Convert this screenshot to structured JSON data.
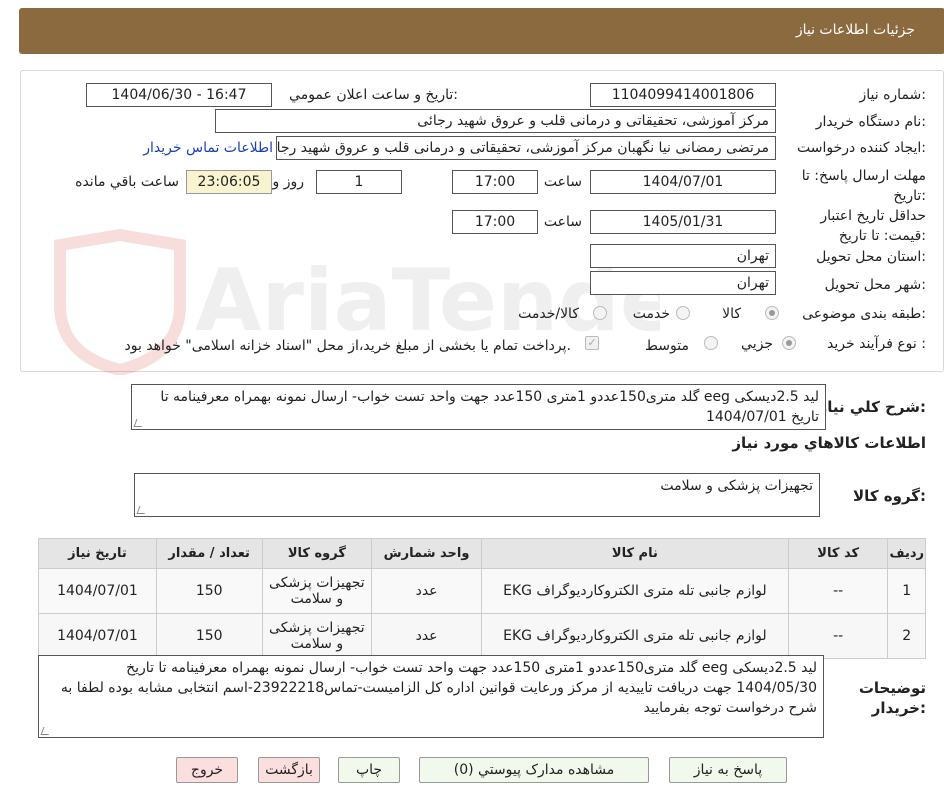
{
  "header": {
    "title": "جزئیات اطلاعات نیاز"
  },
  "fields": {
    "need_number_label": "شماره نیاز:",
    "need_number": "1104099414001806",
    "announce_label": "تاریخ و ساعت اعلان عمومي:",
    "announce_value": "1404/06/30 - 16:47",
    "buyer_org_label": "نام دستگاه خریدار:",
    "buyer_org": "مرکز آموزشی، تحقیقاتی و درمانی قلب و عروق شهید رجائی",
    "creator_label": "ایجاد کننده درخواست:",
    "creator": "مرتضی رمضانی نیا نگهبان مرکز آموزشی، تحقیقاتی و درمانی قلب و عروق شهید رجائی",
    "buyer_contact_link": "اطلاعات تماس خریدار",
    "deadline_label": "مهلت ارسال پاسخ: تا تاریخ:",
    "deadline_date": "1404/07/01",
    "time_label": "ساعت",
    "deadline_time": "17:00",
    "days_value": "1",
    "days_label": "روز و",
    "remaining_time": "23:06:05",
    "remaining_label": "ساعت باقي مانده",
    "validity_label": "حداقل تاریخ اعتبار قیمت: تا تاریخ:",
    "validity_date": "1405/01/31",
    "validity_time": "17:00",
    "province_label": "استان محل تحویل:",
    "province": "تهران",
    "city_label": "شهر محل تحویل:",
    "city": "تهران",
    "category_label": "طبقه بندی موضوعی:",
    "category_options": [
      "کالا",
      "خدمت",
      "کالا/خدمت"
    ],
    "process_label": "نوع فرآیند خرید :",
    "process_options": [
      "جزیي",
      "متوسط"
    ],
    "payment_note": "پرداخت تمام یا بخشی از مبلغ خرید،از محل \"اسناد خزانه اسلامی\" خواهد بود."
  },
  "description": {
    "label": "شرح کلي نیاز:",
    "text": "لید 2.5دیسکی  eeg گلد متری150عددو 1متری 150عدد جهت واحد تست خواب- ارسال نمونه بهمراه معرفینامه تا تاریخ 1404/07/01"
  },
  "goods_section": {
    "title": "اطلاعات کالاهاي مورد نیاز",
    "group_label": "گروه کالا:",
    "group_value": "تجهیزات پزشکی و سلامت"
  },
  "table": {
    "headers": [
      "ردیف",
      "کد کالا",
      "نام کالا",
      "واحد شمارش",
      "گروه کالا",
      "تعداد / مقدار",
      "تاریخ نیاز"
    ],
    "rows": [
      [
        "1",
        "--",
        "لوازم جانبی تله متری الکتروکاردیوگراف EKG",
        "عدد",
        "تجهیزات پزشکی و سلامت",
        "150",
        "1404/07/01"
      ],
      [
        "2",
        "--",
        "لوازم جانبی تله متری الکتروکاردیوگراف EKG",
        "عدد",
        "تجهیزات پزشکی و سلامت",
        "150",
        "1404/07/01"
      ]
    ]
  },
  "buyer_notes": {
    "label": "توضیحات خریدار:",
    "text": "لید 2.5دیسکی  eeg گلد متری150عددو 1متری 150عدد جهت واحد تست خواب- ارسال نمونه بهمراه معرفینامه تا تاریخ 1404/05/30 جهت دریافت تاییدیه از مرکز ورعایت قوانین اداره کل الزامیست-تماس23922218-اسم انتخابی مشابه بوده لطفا به شرح درخواست توجه بفرمایید"
  },
  "buttons": {
    "reply": "پاسخ به نیاز",
    "attachments": "مشاهده مدارک پیوستي (0)",
    "print": "چاپ",
    "back": "بازگشت",
    "exit": "خروج"
  },
  "watermark": "AriaTender.neT"
}
